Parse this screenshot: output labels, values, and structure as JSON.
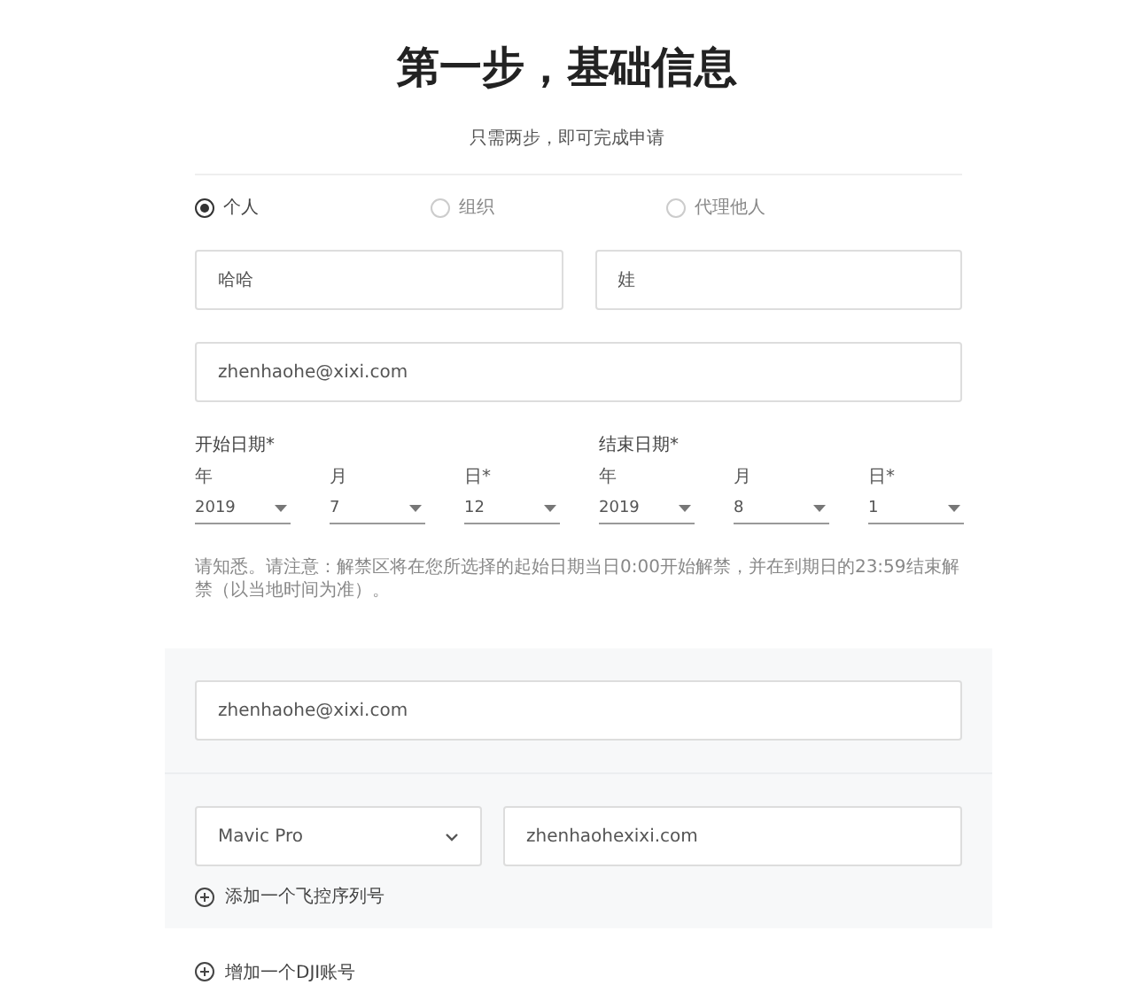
{
  "heading": "第一步，基础信息",
  "subheading": "只需两步，即可完成申请",
  "applicant_types": [
    {
      "label": "个人",
      "selected": true
    },
    {
      "label": "组织",
      "selected": false
    },
    {
      "label": "代理他人",
      "selected": false
    }
  ],
  "name_fields": [
    {
      "value": "哈哈"
    },
    {
      "value": "娃"
    }
  ],
  "email": {
    "value": "zhenhaohe@xixi.com"
  },
  "dates": [
    {
      "label": "开始日期*",
      "parts": [
        {
          "label": "年",
          "value": "2019"
        },
        {
          "label": "月",
          "value": "7"
        },
        {
          "label": "日*",
          "value": "12"
        }
      ]
    },
    {
      "label": "结束日期*",
      "parts": [
        {
          "label": "年",
          "value": "2019"
        },
        {
          "label": "月",
          "value": "8"
        },
        {
          "label": "日*",
          "value": "1"
        }
      ]
    }
  ],
  "notice": "请知悉。请注意：解禁区将在您所选择的起始日期当日0:00开始解禁，并在到期日的23:59结束解禁（以当地时间为准）。",
  "account": {
    "email": {
      "value": "zhenhaohe@xixi.com"
    },
    "devices": [
      {
        "model": "Mavic Pro",
        "serial": "zhenhaohexixi.com"
      }
    ],
    "add_device": "添加一个飞控序列号"
  },
  "add_account": "增加一个DJI账号"
}
